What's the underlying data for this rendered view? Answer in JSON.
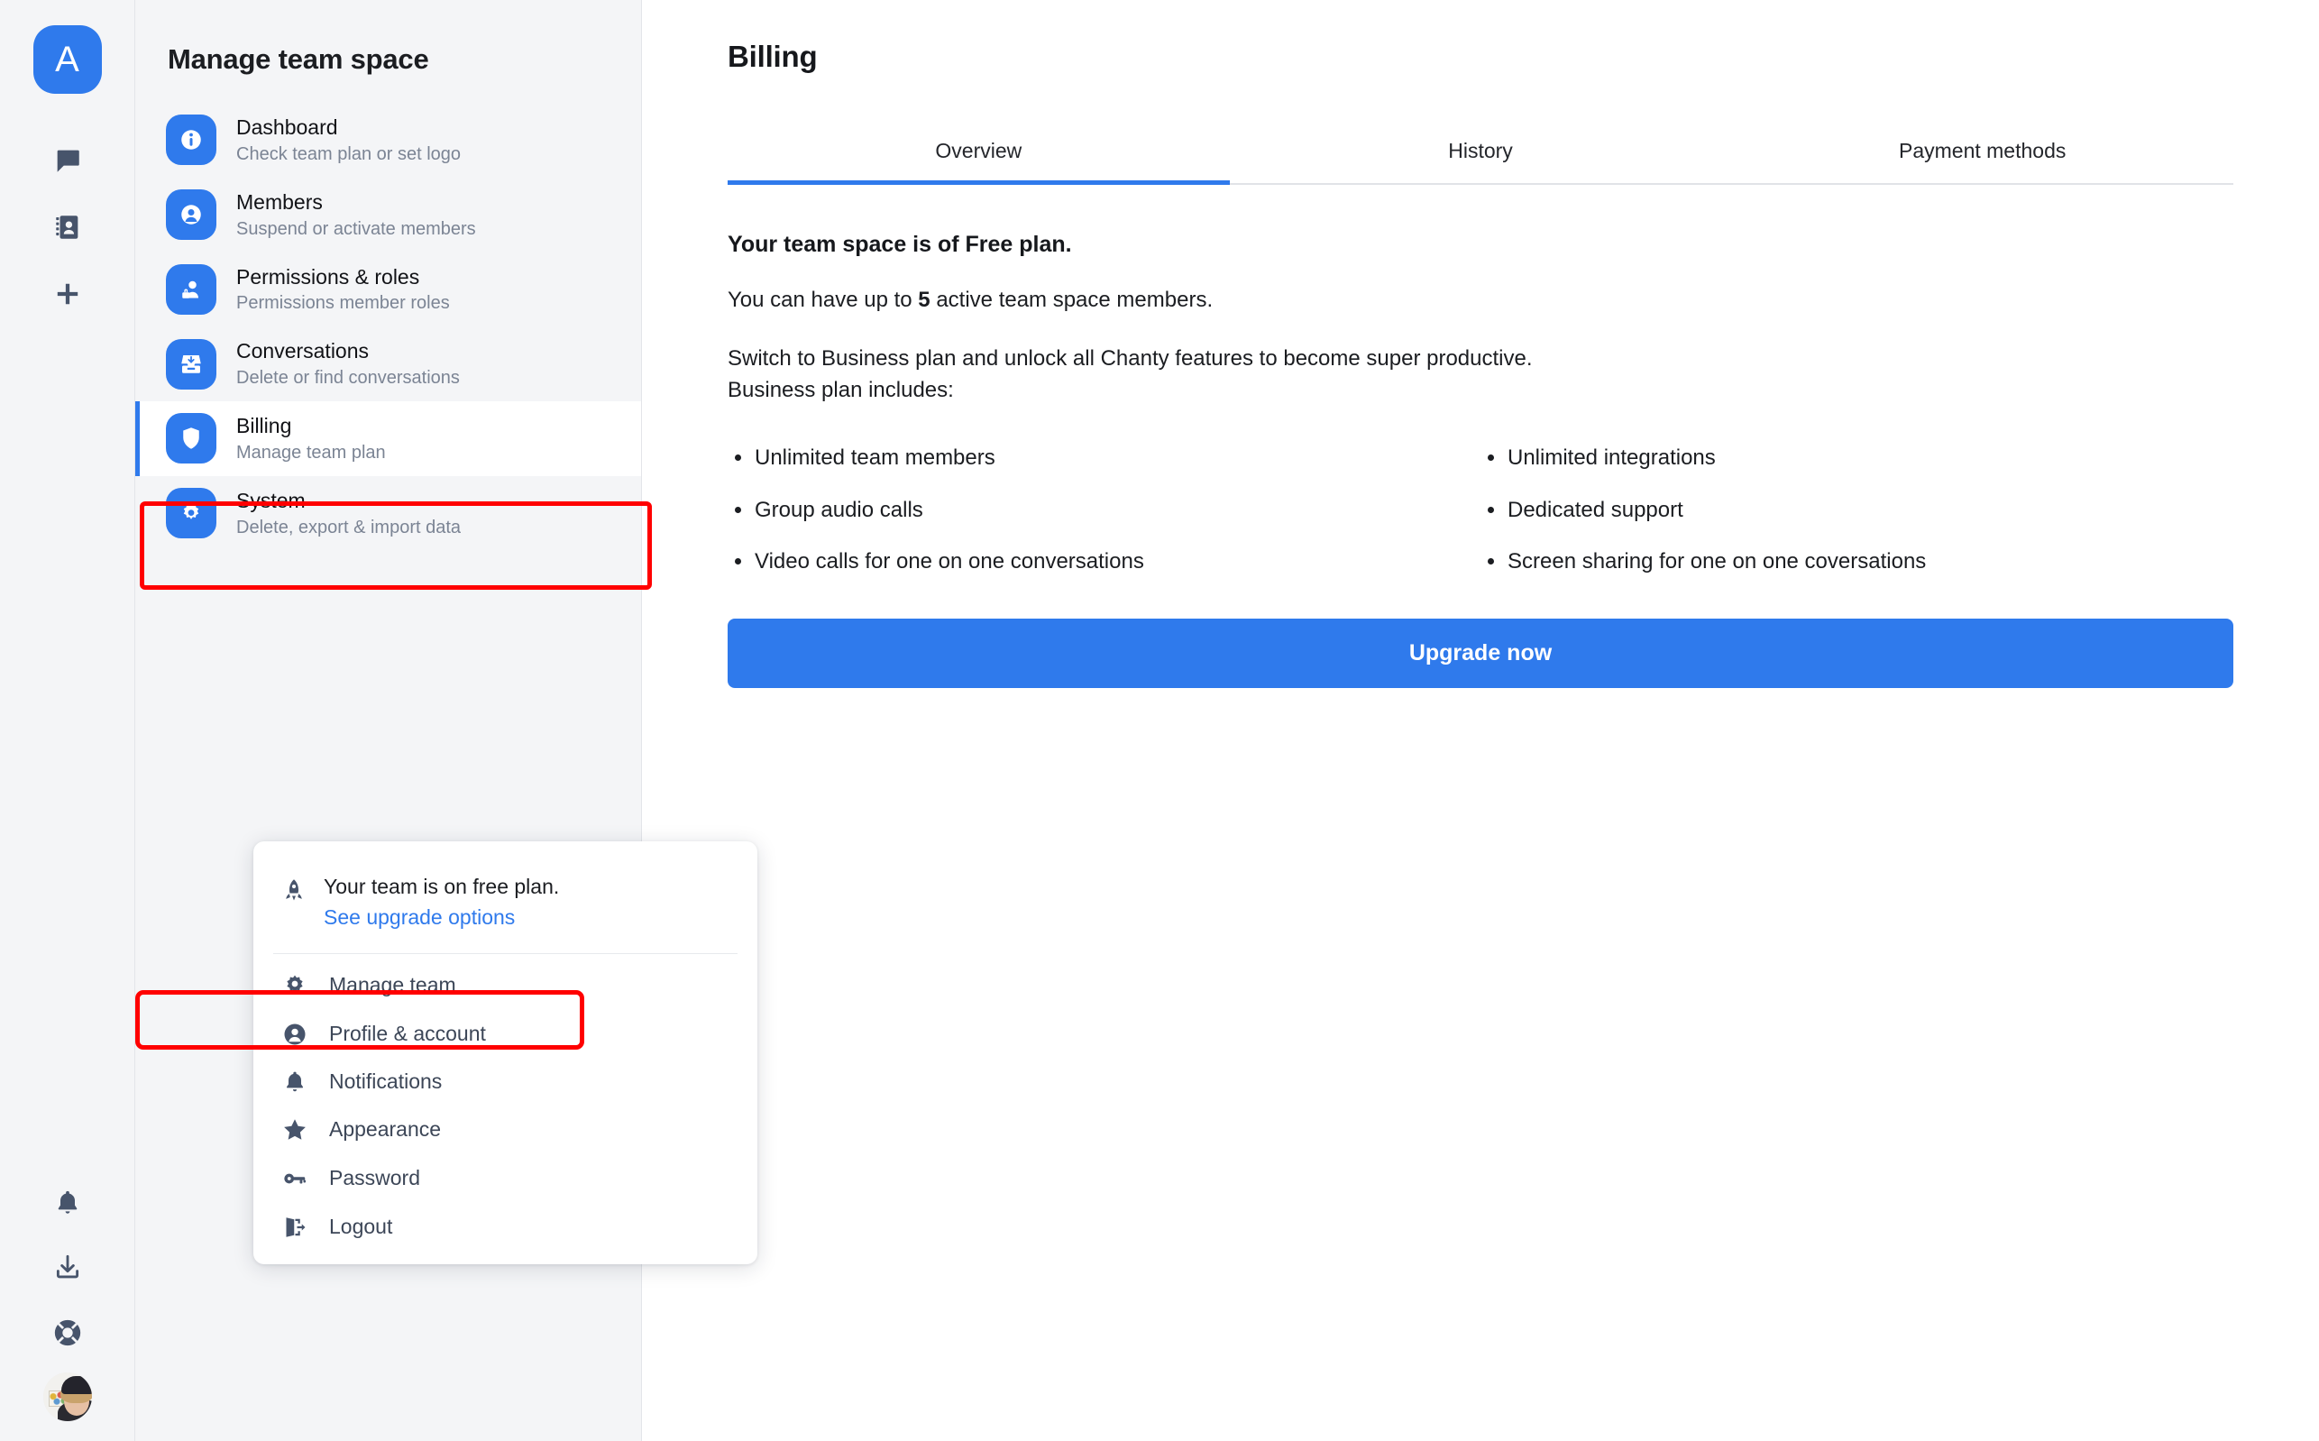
{
  "rail": {
    "workspace_initial": "A",
    "icons": [
      {
        "name": "chat-bubble-icon"
      },
      {
        "name": "contacts-book-icon"
      },
      {
        "name": "plus-icon"
      }
    ],
    "bottom_icons": [
      {
        "name": "bell-icon"
      },
      {
        "name": "download-icon"
      },
      {
        "name": "life-ring-icon"
      }
    ],
    "avatar_name": "user-avatar"
  },
  "sidebar": {
    "title": "Manage team space",
    "items": [
      {
        "label": "Dashboard",
        "desc": "Check team plan or set logo",
        "icon": "info-icon",
        "active": false
      },
      {
        "label": "Members",
        "desc": "Suspend or activate members",
        "icon": "user-circle-icon",
        "active": false
      },
      {
        "label": "Permissions & roles",
        "desc": "Permissions member roles",
        "icon": "user-lock-icon",
        "active": false
      },
      {
        "label": "Conversations",
        "desc": "Delete or find conversations",
        "icon": "inbox-download-icon",
        "active": false
      },
      {
        "label": "Billing",
        "desc": "Manage team plan",
        "icon": "shield-icon",
        "active": true
      },
      {
        "label": "System",
        "desc": "Delete, export & import data",
        "icon": "gear-icon",
        "active": false
      }
    ]
  },
  "dropdown": {
    "plan_text": "Your team is on free plan.",
    "plan_link": "See upgrade options",
    "plan_icon": "rocket-icon",
    "items": [
      {
        "label": "Manage team",
        "icon": "gear-icon",
        "highlighted": true
      },
      {
        "label": "Profile & account",
        "icon": "user-circle-icon",
        "highlighted": false
      },
      {
        "label": "Notifications",
        "icon": "bell-icon",
        "highlighted": false
      },
      {
        "label": "Appearance",
        "icon": "star-icon",
        "highlighted": false
      },
      {
        "label": "Password",
        "icon": "key-icon",
        "highlighted": false
      },
      {
        "label": "Logout",
        "icon": "logout-icon",
        "highlighted": false
      }
    ]
  },
  "main": {
    "page_title": "Billing",
    "tabs": [
      {
        "label": "Overview",
        "active": true
      },
      {
        "label": "History",
        "active": false
      },
      {
        "label": "Payment methods",
        "active": false
      }
    ],
    "lead": "Your team space is of Free plan.",
    "limit_prefix": "You can have up to ",
    "limit_value": "5",
    "limit_suffix": " active team space members.",
    "switch_line": "Switch to Business plan and unlock all Chanty features to become super productive.",
    "includes_line": "Business plan includes:",
    "features_left": [
      "Unlimited team members",
      "Group audio calls",
      "Video calls for one on one conversations"
    ],
    "features_right": [
      "Unlimited integrations",
      "Dedicated support",
      "Screen sharing for one on one coversations"
    ],
    "upgrade_label": "Upgrade now"
  },
  "colors": {
    "accent": "#2f7aec",
    "highlight": "#ff0000",
    "sidebar_bg": "#f4f5f7",
    "text": "#1b1d21",
    "muted": "#7b8494"
  }
}
